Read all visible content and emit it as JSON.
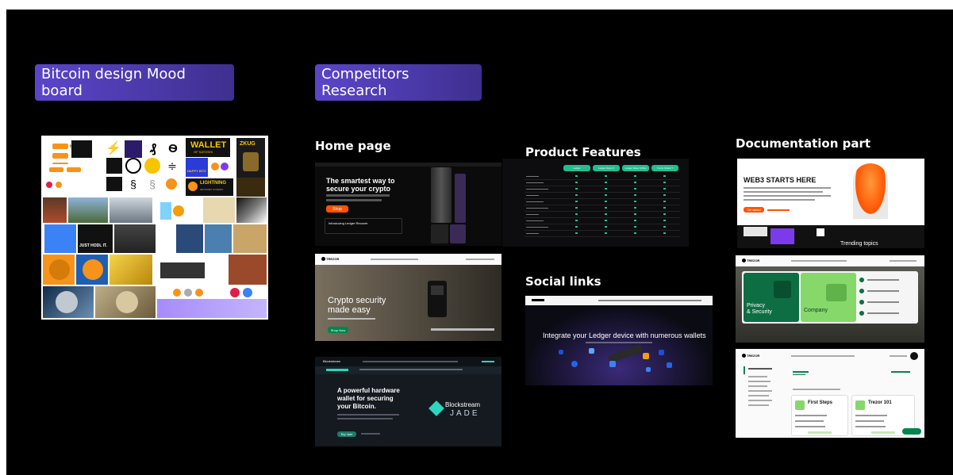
{
  "labels": {
    "mood_board": "Bitcoin design Mood board",
    "competitors": "Competitors Research"
  },
  "sections": {
    "home_page": "Home page",
    "product_features": "Product Features",
    "social_links": "Social links",
    "documentation": "Documentation part"
  },
  "moodboard": {
    "logo_bitcoin": "bitcoin",
    "wallet_title": "WALLET",
    "wallet_sub": "OF SATOSHI",
    "zk_badge": "ZKUG",
    "lightning": "LIGHTNING",
    "lightning_sub": "NETWORK STORIES",
    "happy_bitz": "HAPPY BITZ",
    "hodl": "JUST HODL IT."
  },
  "ledger_home": {
    "tagline": "The smartest way to",
    "tagline2": "secure your crypto",
    "cta": "Shop",
    "banner": "Introducing Ledger Recover"
  },
  "trezor_home": {
    "logo": "TREZOR",
    "headline1": "Crypto security",
    "headline2": "made easy",
    "cta": "Shop Now"
  },
  "jade_home": {
    "logo": "Blockstream",
    "headline1": "A powerful hardware",
    "headline2": "wallet for securing",
    "headline3": "your Bitcoin.",
    "brand1": "Blockstream",
    "brand2": "JADE",
    "cta": "Buy Jade"
  },
  "features_table": {
    "columns": [
      "Ledger",
      "Ledger Nano X",
      "Ledger Nano S Plus",
      "Trezor Model T"
    ]
  },
  "social": {
    "headline": "Integrate your Ledger device with numerous wallets"
  },
  "web3": {
    "headline": "WEB3 STARTS HERE",
    "cta": "Get started",
    "trending": "Trending topics"
  },
  "trezor_docs": {
    "logo": "TREZOR",
    "card1_line1": "Privacy",
    "card1_line2": "& Security",
    "card2": "Company"
  },
  "trezor_suite": {
    "logo": "TREZOR",
    "heading": "First Steps",
    "heading2": "Trezor 101"
  },
  "colors": {
    "pill": "#4a39a8",
    "ledger_orange": "#ff5300",
    "trezor_green": "#00854d",
    "jade_teal": "#2dd4bf",
    "table_teal": "#1fbf8f"
  }
}
